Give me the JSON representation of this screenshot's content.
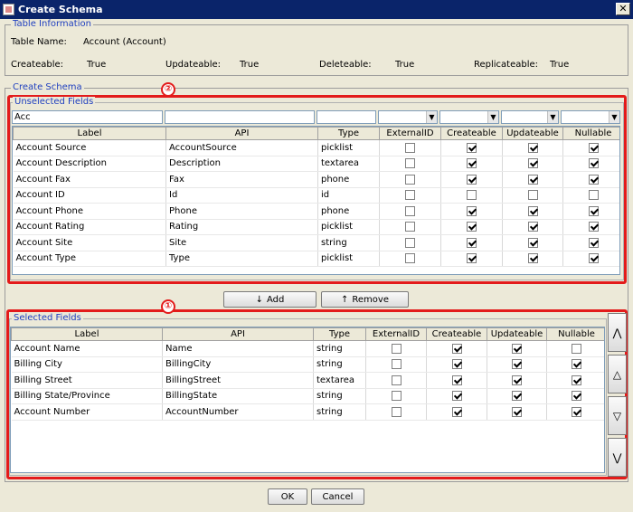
{
  "window": {
    "title": "Create Schema",
    "close": "✕"
  },
  "table_info": {
    "legend": "Table Information",
    "table_name_label": "Table Name:",
    "table_name_value": "Account  (Account)",
    "createable_label": "Createable:",
    "createable_value": "True",
    "updateable_label": "Updateable:",
    "updateable_value": "True",
    "deleteable_label": "Deleteable:",
    "deleteable_value": "True",
    "replicateable_label": "Replicateable:",
    "replicateable_value": "True"
  },
  "create_schema": {
    "legend": "Create Schema"
  },
  "unselected": {
    "legend": "Unselected Fields",
    "badge": "②",
    "filter_label": "Acc",
    "filter_api": "",
    "filter_type": "",
    "columns": [
      "Label",
      "API",
      "Type",
      "ExternalID",
      "Createable",
      "Updateable",
      "Nullable"
    ],
    "rows": [
      {
        "label": "Account Source",
        "api": "AccountSource",
        "type": "picklist",
        "ext": false,
        "cre": true,
        "upd": true,
        "nul": true
      },
      {
        "label": "Account Description",
        "api": "Description",
        "type": "textarea",
        "ext": false,
        "cre": true,
        "upd": true,
        "nul": true
      },
      {
        "label": "Account Fax",
        "api": "Fax",
        "type": "phone",
        "ext": false,
        "cre": true,
        "upd": true,
        "nul": true
      },
      {
        "label": "Account ID",
        "api": "Id",
        "type": "id",
        "ext": false,
        "cre": false,
        "upd": false,
        "nul": false
      },
      {
        "label": "Account Phone",
        "api": "Phone",
        "type": "phone",
        "ext": false,
        "cre": true,
        "upd": true,
        "nul": true
      },
      {
        "label": "Account Rating",
        "api": "Rating",
        "type": "picklist",
        "ext": false,
        "cre": true,
        "upd": true,
        "nul": true
      },
      {
        "label": "Account Site",
        "api": "Site",
        "type": "string",
        "ext": false,
        "cre": true,
        "upd": true,
        "nul": true
      },
      {
        "label": "Account Type",
        "api": "Type",
        "type": "picklist",
        "ext": false,
        "cre": true,
        "upd": true,
        "nul": true
      }
    ]
  },
  "actions": {
    "add_icon": "↓",
    "add": "Add",
    "remove_icon": "↑",
    "remove": "Remove"
  },
  "selected": {
    "legend": "Selected Fields",
    "badge": "①",
    "columns": [
      "Label",
      "API",
      "Type",
      "ExternalID",
      "Createable",
      "Updateable",
      "Nullable"
    ],
    "rows": [
      {
        "label": "Account Name",
        "api": "Name",
        "type": "string",
        "ext": false,
        "cre": true,
        "upd": true,
        "nul": false
      },
      {
        "label": "Billing City",
        "api": "BillingCity",
        "type": "string",
        "ext": false,
        "cre": true,
        "upd": true,
        "nul": true
      },
      {
        "label": "Billing Street",
        "api": "BillingStreet",
        "type": "textarea",
        "ext": false,
        "cre": true,
        "upd": true,
        "nul": true
      },
      {
        "label": "Billing State/Province",
        "api": "BillingState",
        "type": "string",
        "ext": false,
        "cre": true,
        "upd": true,
        "nul": true
      },
      {
        "label": "Account Number",
        "api": "AccountNumber",
        "type": "string",
        "ext": false,
        "cre": true,
        "upd": true,
        "nul": true
      }
    ],
    "move_top": "⋀",
    "move_up": "△",
    "move_down": "▽",
    "move_bottom": "⋁"
  },
  "footer": {
    "ok": "OK",
    "cancel": "Cancel"
  }
}
